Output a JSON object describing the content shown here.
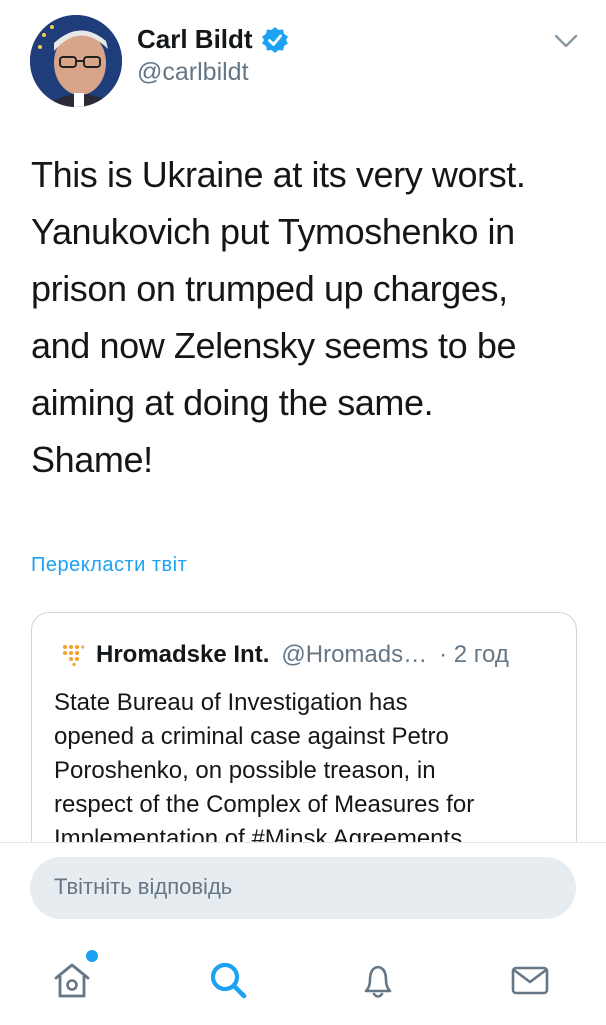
{
  "tweet": {
    "author_name": "Carl Bildt",
    "author_handle": "@carlbildt",
    "text_lines": [
      "This is Ukraine at its very worst.",
      "Yanukovich put Tymoshenko in",
      "prison on trumped up charges,",
      "and now Zelensky seems to be",
      "aiming at doing the same.",
      "Shame!"
    ],
    "translate_label": "Перекласти твіт"
  },
  "quoted": {
    "name": "Hromadske Int.",
    "handle": "@Hromads…",
    "time": "· 2 год",
    "text_lines": [
      "State Bureau of Investigation has",
      "opened a criminal case against Petro",
      "Poroshenko, on possible treason, in",
      "respect of the Complex of Measures for",
      "Implementation of #Minsk Agreements"
    ]
  },
  "reply": {
    "placeholder": "Твітніть відповідь"
  },
  "colors": {
    "accent": "#1da1f2",
    "secondary_text": "#657786",
    "border": "#ccd6dd"
  },
  "icons": {
    "verified": "verified-badge-icon",
    "more": "chevron-down-icon",
    "home": "home-icon",
    "search": "search-icon",
    "notifications": "bell-icon",
    "messages": "envelope-icon"
  }
}
